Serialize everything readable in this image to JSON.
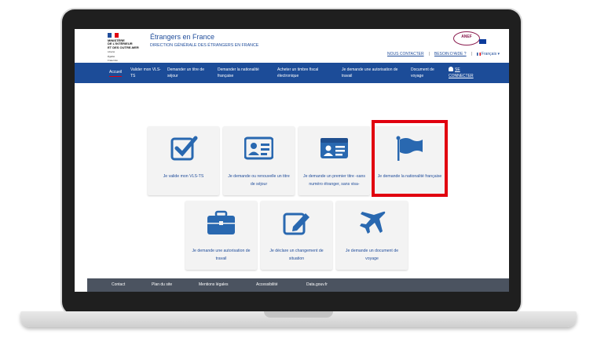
{
  "header": {
    "ministry_lines": [
      "MINISTÈRE",
      "DE L'INTÉRIEUR",
      "ET DES OUTRE-MER"
    ],
    "motto_lines": [
      "Liberté",
      "Égalité",
      "Fraternité"
    ],
    "site_title": "Étrangers en France",
    "site_subtitle": "DIRECTION GÉNÉRALE DES ÉTRANGERS EN FRANCE",
    "anef_logo": "ANEF",
    "links": {
      "contact": "NOUS CONTACTER",
      "help": "BESOIN D'AIDE ?",
      "language": "Français"
    }
  },
  "nav": {
    "items": [
      {
        "label": "Accueil"
      },
      {
        "label": "Valider mon VLS-TS"
      },
      {
        "label": "Demander un titre de séjour"
      },
      {
        "label": "Demander la nationalité française"
      },
      {
        "label": "Acheter un timbre fiscal électronique"
      },
      {
        "label": "Je demande une autorisation de travail"
      },
      {
        "label": "Document de voyage"
      }
    ],
    "login": "SE CONNECTER"
  },
  "tiles": [
    {
      "label": "Je valide mon VLS-TS",
      "icon": "checkbox-icon"
    },
    {
      "label": "Je demande ou renouvelle un titre de séjour",
      "icon": "id-card-icon"
    },
    {
      "label": "Je demande un premier titre -sans numéro étranger, sans visa-",
      "icon": "id-card-icon"
    },
    {
      "label": "Je demande la nationalité française",
      "icon": "flag-icon"
    },
    {
      "label": "Je demande une autorisation de travail",
      "icon": "briefcase-icon"
    },
    {
      "label": "Je déclare un changement de situation",
      "icon": "edit-icon"
    },
    {
      "label": "Je demande un document de voyage",
      "icon": "airplane-icon"
    }
  ],
  "footer": {
    "items": [
      "Contact",
      "Plan du site",
      "Mentions légales",
      "Accessibilité",
      "Data.gouv.fr"
    ]
  },
  "colors": {
    "accent": "#1c4c98",
    "highlight": "#e1000f",
    "footer": "#4b5360"
  }
}
